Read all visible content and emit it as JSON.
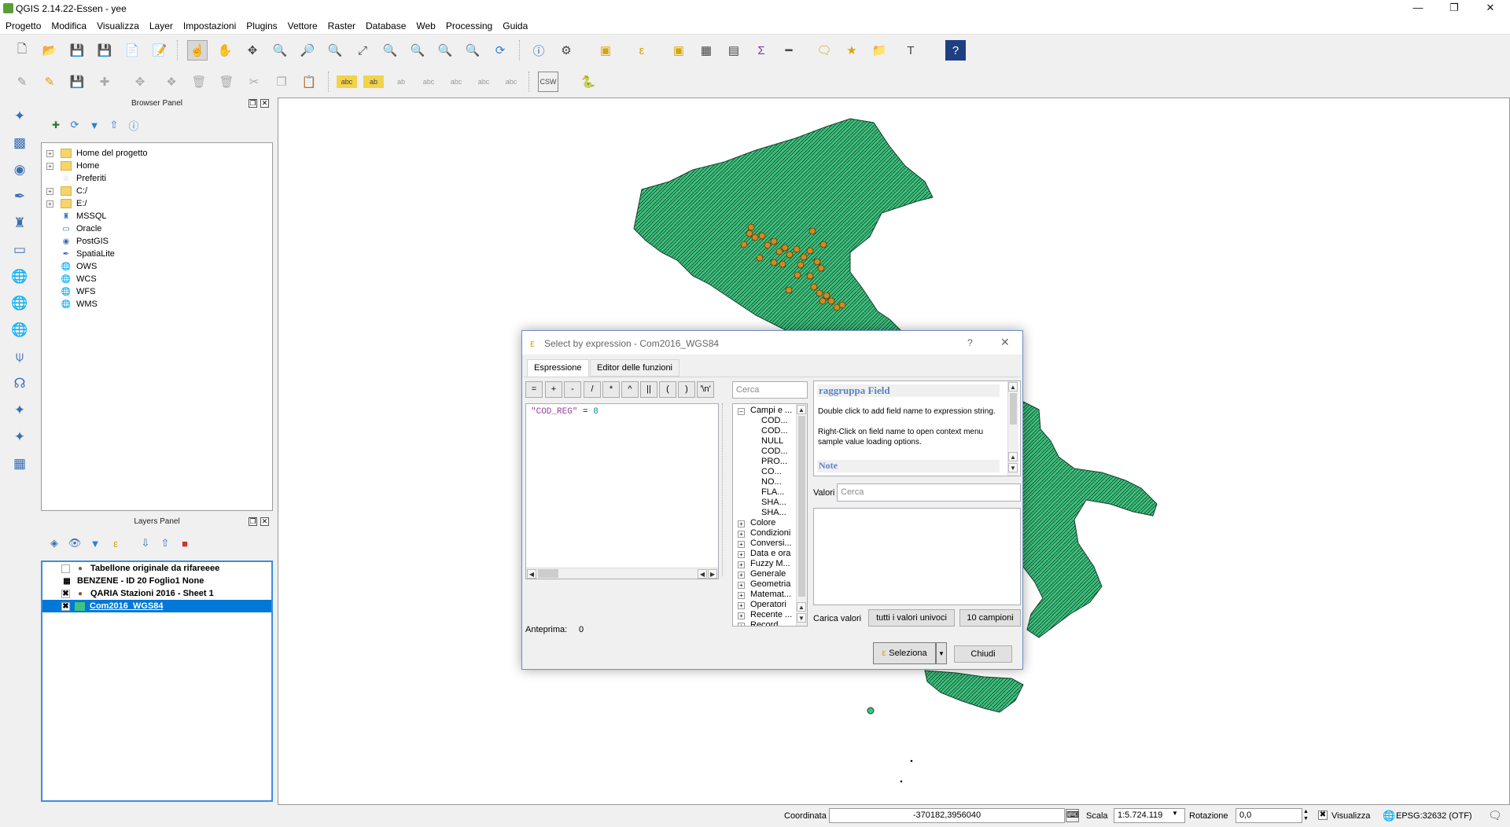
{
  "window": {
    "title": "QGIS 2.14.22-Essen - yee"
  },
  "menu": [
    "Progetto",
    "Modifica",
    "Visualizza",
    "Layer",
    "Impostazioni",
    "Plugins",
    "Vettore",
    "Raster",
    "Database",
    "Web",
    "Processing",
    "Guida"
  ],
  "browser_panel": {
    "title": "Browser Panel",
    "items": [
      "Home del progetto",
      "Home",
      "Preferiti",
      "C:/",
      "E:/",
      "MSSQL",
      "Oracle",
      "PostGIS",
      "SpatiaLite",
      "OWS",
      "WCS",
      "WFS",
      "WMS"
    ]
  },
  "layers_panel": {
    "title": "Layers Panel",
    "layers": [
      "Tabellone originale da rifareeee",
      "BENZENE - ID 20 Foglio1 None",
      "QARIA Stazioni 2016 - Sheet 1",
      "Com2016_WGS84"
    ]
  },
  "dialog": {
    "title": "Select by expression - Com2016_WGS84",
    "help_glyph": "?",
    "close_glyph": "✕",
    "tabs": [
      "Espressione",
      "Editor delle funzioni"
    ],
    "operators": [
      "=",
      "+",
      "-",
      "/",
      "*",
      "^",
      "||",
      "(",
      ")",
      "'\\n'"
    ],
    "expression_field": "\"COD_REG\"",
    "expression_op": "=",
    "expression_value": "8",
    "preview_label": "Anteprima:",
    "preview_value": "0",
    "search_placeholder": "Cerca",
    "fields_group": "Campi e ...",
    "fields": [
      "COD...",
      "COD...",
      "NULL",
      "COD...",
      "PRO...",
      "CO...",
      "NO...",
      "FLA...",
      "SHA...",
      "SHA..."
    ],
    "groups": [
      "Colore",
      "Condizioni",
      "Conversi...",
      "Data e ora",
      "Fuzzy M...",
      "Generale",
      "Geometria",
      "Matemat...",
      "Operatori",
      "Recente ...",
      "Record"
    ],
    "help_title": "raggruppa Field",
    "help_text_1": "Double click to add field name to expression string.",
    "help_text_2": "Right-Click on field name to open context menu sample value loading options.",
    "help_note": "Note",
    "values_label": "Valori",
    "values_placeholder": "Cerca",
    "load_values_label": "Carica valori",
    "all_unique_button": "tutti i valori univoci",
    "sample_button": "10 campioni",
    "select_button": "Seleziona",
    "close_button": "Chiudi"
  },
  "statusbar": {
    "coord_label": "Coordinata",
    "coord_value": "-370182,3956040",
    "scale_label": "Scala",
    "scale_value": "1:5.724.119",
    "rotation_label": "Rotazione",
    "rotation_value": "0,0",
    "render_label": "Visualizza",
    "crs": "EPSG:32632 (OTF)"
  },
  "colors": {
    "map_fill": "#3ec47f",
    "points": "#d08a1e",
    "selection": "#0078d7",
    "help_title": "#5b82c8"
  }
}
